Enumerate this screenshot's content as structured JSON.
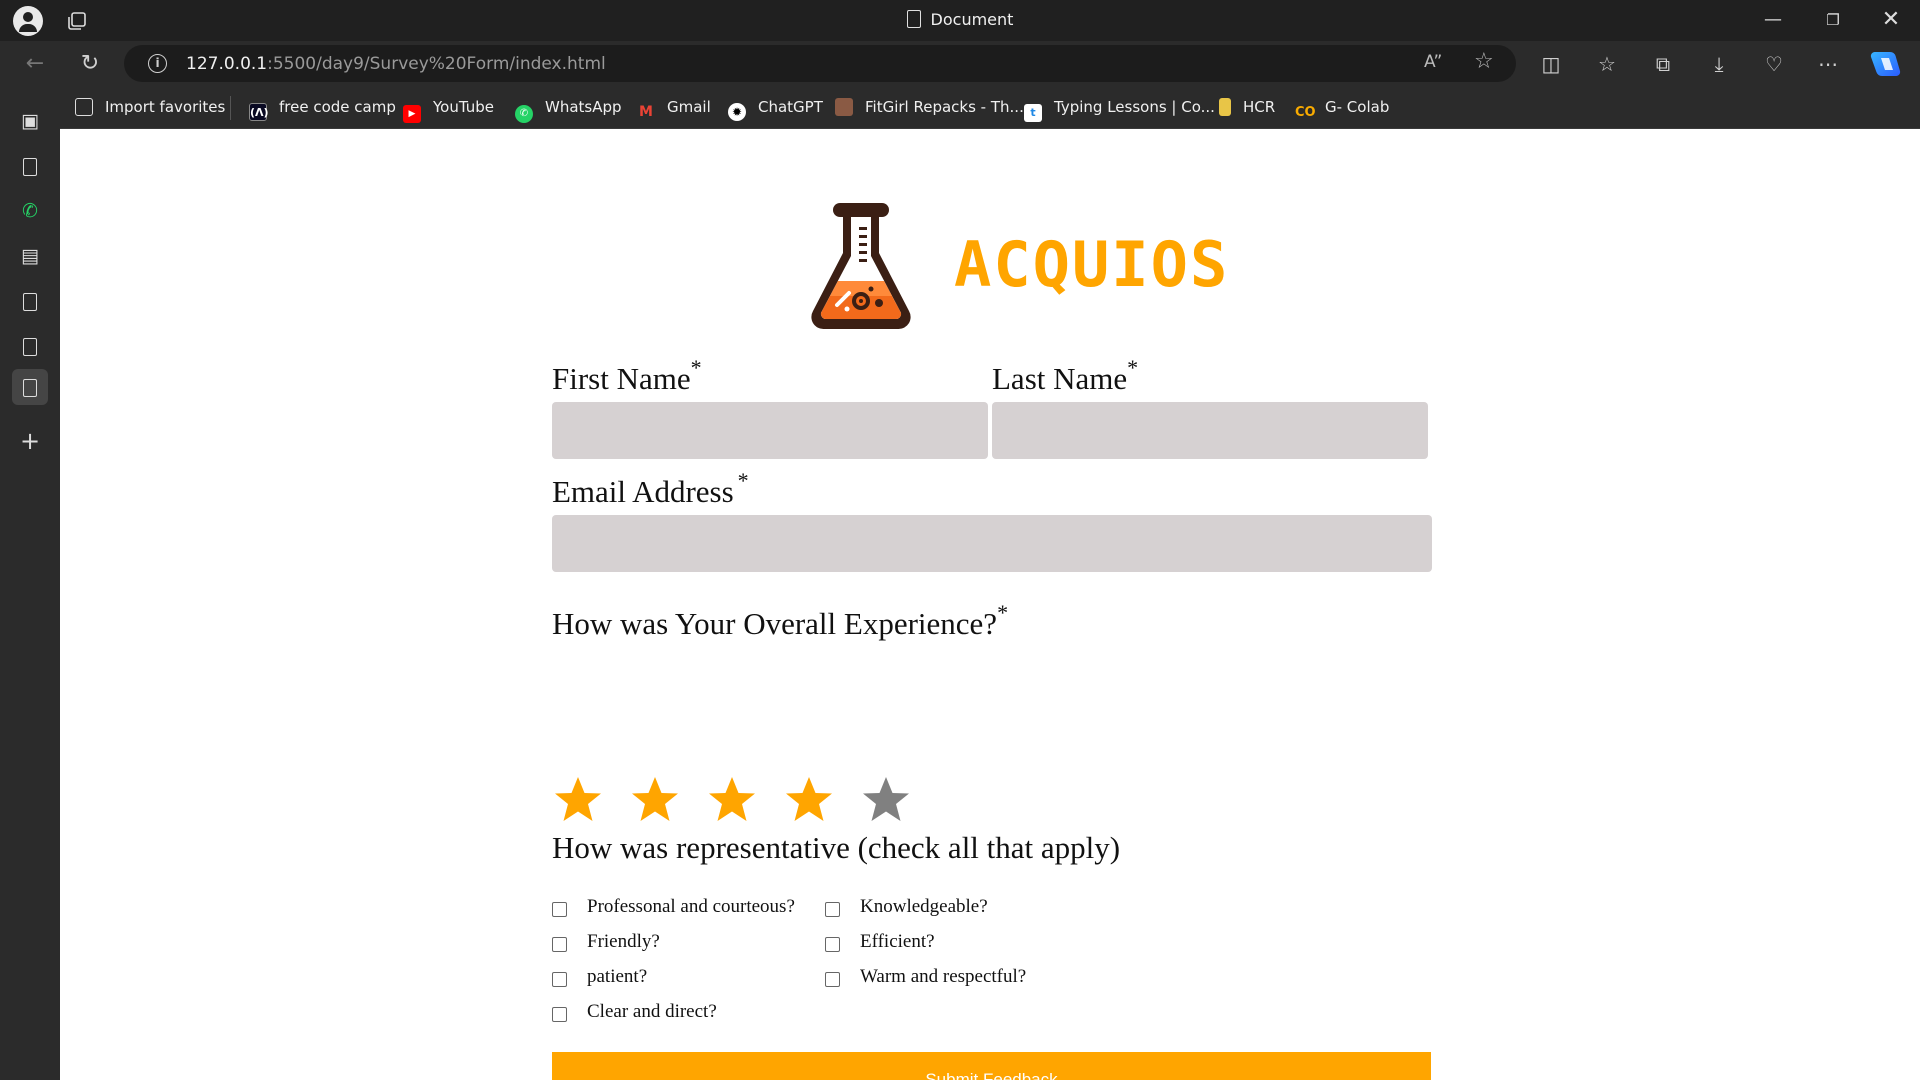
{
  "browser": {
    "window_title": "Document",
    "url_host": "127.0.0.1",
    "url_path": ":5500/day9/Survey%20Form/index.html",
    "bookmarks": [
      {
        "label": "Import favorites",
        "icon": "import-icon"
      },
      {
        "label": "free code camp",
        "icon": "freecodecamp-icon"
      },
      {
        "label": "YouTube",
        "icon": "youtube-icon"
      },
      {
        "label": "WhatsApp",
        "icon": "whatsapp-icon"
      },
      {
        "label": "Gmail",
        "icon": "gmail-icon"
      },
      {
        "label": "ChatGPT",
        "icon": "chatgpt-icon"
      },
      {
        "label": "FitGirl Repacks - Th...",
        "icon": "fitgirl-icon"
      },
      {
        "label": "Typing Lessons | Co...",
        "icon": "typing-icon"
      },
      {
        "label": "HCR",
        "icon": "hcr-icon"
      },
      {
        "label": "G- Colab",
        "icon": "colab-icon"
      }
    ]
  },
  "page": {
    "brand": "ACQUIOS",
    "brand_color": "#FFA500",
    "first_name": {
      "label": "First Name",
      "required": "*",
      "value": ""
    },
    "last_name": {
      "label": "Last Name",
      "required": "*",
      "value": ""
    },
    "email": {
      "label": "Email Address",
      "required": "*",
      "value": ""
    },
    "experience": {
      "label": "How was Your Overall Experience?",
      "required": "*",
      "rating": 4,
      "max": 5
    },
    "representative": {
      "label": "How was representative (check all that apply)",
      "options": [
        {
          "label": "Professonal and courteous?",
          "checked": false
        },
        {
          "label": "Knowledgeable?",
          "checked": false
        },
        {
          "label": "Friendly?",
          "checked": false
        },
        {
          "label": "Efficient?",
          "checked": false
        },
        {
          "label": "patient?",
          "checked": false
        },
        {
          "label": "Warm and respectful?",
          "checked": false
        },
        {
          "label": "Clear and direct?",
          "checked": false
        }
      ]
    },
    "submit_label": "Submit Feedback"
  }
}
